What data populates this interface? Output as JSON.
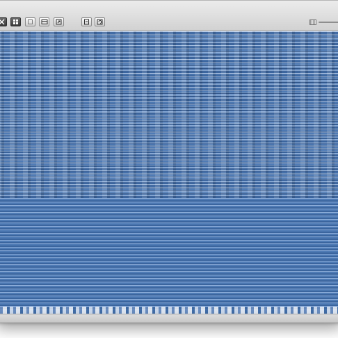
{
  "window": {
    "toolbar": {
      "buttons": [
        {
          "name": "view-icons-button",
          "icon": "close-x-icon"
        },
        {
          "name": "view-fullscreen-button",
          "icon": "expand-arrows-icon"
        },
        {
          "name": "view-list-button",
          "icon": "list-icon"
        },
        {
          "name": "view-columns-button",
          "icon": "columns-icon"
        },
        {
          "name": "view-coverflow-button",
          "icon": "resize-icon"
        },
        {
          "name": "action-button",
          "icon": "page-icon"
        },
        {
          "name": "refresh-button",
          "icon": "rotate-icon"
        }
      ],
      "zoom_slider": {
        "icon": "thumbnail-icon",
        "level": 0.0
      }
    },
    "content": {
      "description_state": "image-preview"
    },
    "accent_color": "#4f7bb5"
  }
}
